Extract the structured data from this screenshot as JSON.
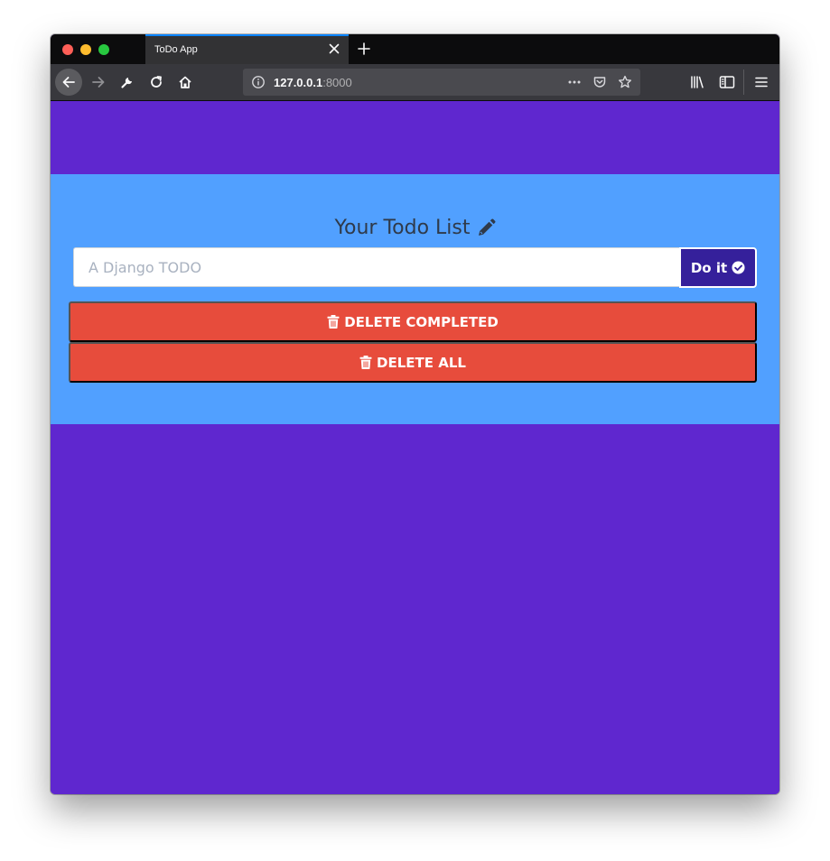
{
  "browser": {
    "tab_title": "ToDo App",
    "url_host": "127.0.0.1",
    "url_port": ":8000"
  },
  "page": {
    "heading": "Your Todo List",
    "input_placeholder": "A Django TODO",
    "input_value": "",
    "submit_label": "Do it",
    "delete_completed_label": "DELETE COMPLETED",
    "delete_all_label": "DELETE ALL"
  },
  "icons": {
    "heading": "pencil-icon",
    "submit": "check-circle-icon",
    "delete": "trash-icon"
  },
  "colors": {
    "page_background": "#5f27cf",
    "panel_background": "#51a0ff",
    "submit_button": "#35209b",
    "delete_buttons": "#e74c3c"
  }
}
